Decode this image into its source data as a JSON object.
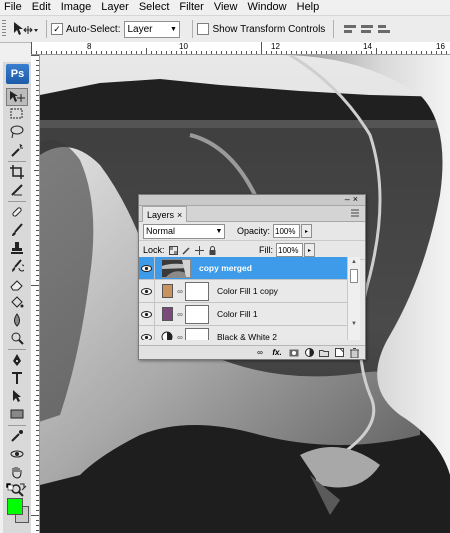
{
  "menu": {
    "items": [
      "File",
      "Edit",
      "Image",
      "Layer",
      "Select",
      "Filter",
      "View",
      "Window",
      "Help"
    ]
  },
  "options_bar": {
    "auto_select_label": "Auto-Select:",
    "auto_select_checked": true,
    "auto_select_target": "Layer",
    "show_transform_label": "Show Transform Controls",
    "show_transform_checked": false
  },
  "toolbox": {
    "logo": "Ps",
    "foreground_color": "#00ff00",
    "background_color": "#c8c8c8"
  },
  "ruler": {
    "labels": [
      "8",
      "10",
      "12",
      "14",
      "16"
    ]
  },
  "layers_panel": {
    "tab_label": "Layers",
    "blend_mode": "Normal",
    "opacity_label": "Opacity:",
    "opacity_value": "100%",
    "lock_label": "Lock:",
    "fill_label": "Fill:",
    "fill_value": "100%",
    "layers": [
      {
        "name": "copy merged",
        "type": "image",
        "selected": true,
        "visible": true
      },
      {
        "name": "Color Fill 1 copy",
        "type": "fill",
        "color": "#c8935f",
        "visible": true
      },
      {
        "name": "Color Fill 1",
        "type": "fill",
        "color": "#7a4a7a",
        "visible": true
      },
      {
        "name": "Black & White 2",
        "type": "adjustment",
        "visible": true
      }
    ],
    "footer_icons": [
      "link-layers-icon",
      "fx-icon",
      "add-mask-icon",
      "adjustment-layer-icon",
      "group-icon",
      "new-layer-icon",
      "trash-icon"
    ],
    "fx_label": "fx."
  },
  "colors": {
    "selected_row": "#3d9be9"
  }
}
